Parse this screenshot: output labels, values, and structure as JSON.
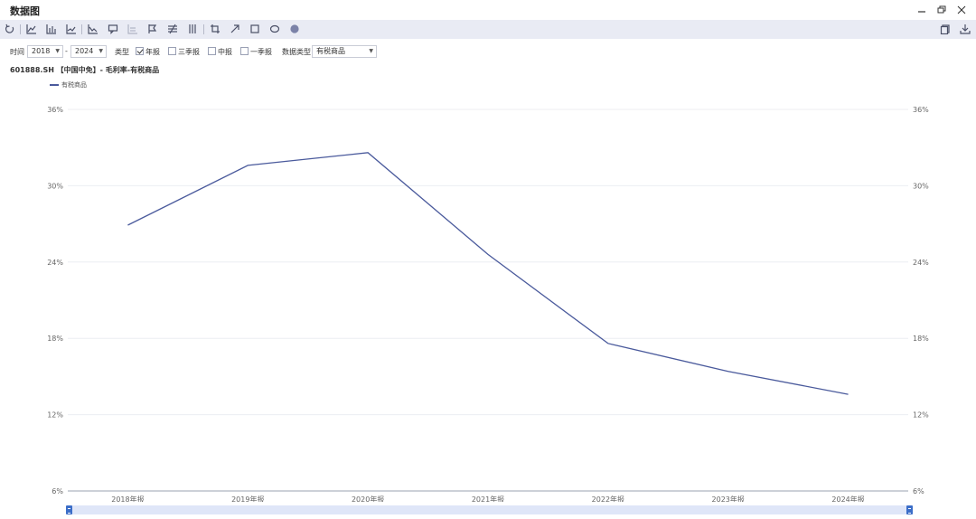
{
  "window": {
    "title": "数据图"
  },
  "toolbar": {
    "icons": [
      "reset-icon",
      "area-chart-icon",
      "bar-chart-icon",
      "line-chart-icon",
      "trend-icon",
      "comment-icon",
      "stack-icon",
      "flag-icon",
      "align-icon",
      "columns-icon",
      "crop-icon",
      "arrow-icon",
      "rectangle-icon",
      "ellipse-icon",
      "circle-fill-icon"
    ],
    "right_icons": [
      "copy-icon",
      "download-icon"
    ]
  },
  "filters": {
    "time_label": "时间",
    "start_year": "2018",
    "dash": "-",
    "end_year": "2024",
    "type_label": "类型",
    "annual": {
      "label": "年报",
      "checked": true
    },
    "q3": {
      "label": "三季报",
      "checked": false
    },
    "interim": {
      "label": "中报",
      "checked": false
    },
    "q1": {
      "label": "一季报",
      "checked": false
    },
    "data_type_label": "数据类型",
    "data_type_value": "有税商品"
  },
  "chart_title": "601888.SH 【中国中免】- 毛利率-有税商品",
  "chart_data": {
    "type": "line",
    "categories": [
      "2018年报",
      "2019年报",
      "2020年报",
      "2021年报",
      "2022年报",
      "2023年报",
      "2024年报"
    ],
    "series": [
      {
        "name": "有税商品",
        "values": [
          26.9,
          31.6,
          32.6,
          24.6,
          17.6,
          15.4,
          13.6
        ],
        "color": "#4a5a9c"
      }
    ],
    "y_ticks": [
      "36%",
      "30%",
      "24%",
      "18%",
      "12%",
      "6%"
    ],
    "y_tick_values": [
      36,
      30,
      24,
      18,
      12,
      6
    ],
    "ylim": [
      6,
      36
    ],
    "grid": true,
    "legend_position": "top-left",
    "dual_y_axis": true
  }
}
